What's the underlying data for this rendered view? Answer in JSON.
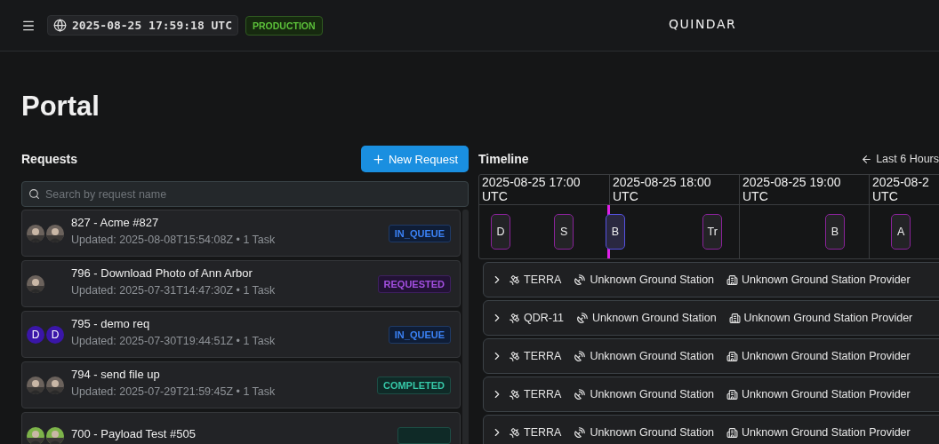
{
  "header": {
    "time": "2025-08-25 17:59:18 UTC",
    "environment": "PRODUCTION",
    "logo": "QUINDAR"
  },
  "page_title": "Portal",
  "requests": {
    "title": "Requests",
    "new_button": "New Request",
    "search": {
      "placeholder": "Search by request name"
    },
    "items": [
      {
        "title": "827 - Acme #827",
        "subtitle": "Updated: 2025-08-08T15:54:08Z • 1 Task",
        "kind": "in_queue",
        "status_label": "IN_QUEUE"
      },
      {
        "title": "796 - Download Photo of Ann Arbor",
        "subtitle": "Updated: 2025-07-31T14:47:30Z • 1 Task",
        "kind": "requested",
        "status_label": "REQUESTED"
      },
      {
        "title": "795 - demo req",
        "subtitle": "Updated: 2025-07-30T19:44:51Z • 1 Task",
        "kind": "in_queue",
        "status_label": "IN_QUEUE",
        "avatars": [
          {
            "kind": "letter",
            "label": "D"
          },
          {
            "kind": "letter",
            "label": "D"
          }
        ]
      },
      {
        "title": "794 - send file up",
        "subtitle": "Updated: 2025-07-29T21:59:45Z • 1 Task",
        "kind": "completed",
        "status_label": "COMPLETED"
      },
      {
        "title": "700 - Payload Test #505",
        "kind": "completed"
      }
    ]
  },
  "timeline": {
    "title": "Timeline",
    "range_button": "Last 6 Hours",
    "now_marker": {
      "level": 0.249
    },
    "columns": [
      {
        "label": "2025-08-25 17:00",
        "sub": "UTC"
      },
      {
        "label": "2025-08-25 18:00",
        "sub": "UTC"
      },
      {
        "label": "2025-08-25 19:00",
        "sub": "UTC"
      },
      {
        "label": "2025-08-2",
        "sub": "UTC"
      }
    ],
    "events": [
      {
        "label": "D",
        "level": 0.041,
        "selected": false
      },
      {
        "label": "S",
        "level": 0.163,
        "selected": false
      },
      {
        "label": "B",
        "level": 0.262,
        "selected": true
      },
      {
        "label": "Tr",
        "level": 0.449,
        "selected": false
      },
      {
        "label": "B",
        "level": 0.685,
        "selected": false
      },
      {
        "label": "A",
        "level": 0.812,
        "selected": false
      }
    ],
    "passes": [
      {
        "satellite": "TERRA",
        "station": "Unknown Ground Station",
        "provider": "Unknown Ground Station Provider"
      },
      {
        "satellite": "QDR-11",
        "station": "Unknown Ground Station",
        "provider": "Unknown Ground Station Provider"
      },
      {
        "satellite": "TERRA",
        "station": "Unknown Ground Station",
        "provider": "Unknown Ground Station Provider"
      },
      {
        "satellite": "TERRA",
        "station": "Unknown Ground Station",
        "provider": "Unknown Ground Station Provider"
      },
      {
        "satellite": "TERRA",
        "station": "Unknown Ground Station",
        "provider": "Unknown Ground Station Provider"
      }
    ]
  }
}
